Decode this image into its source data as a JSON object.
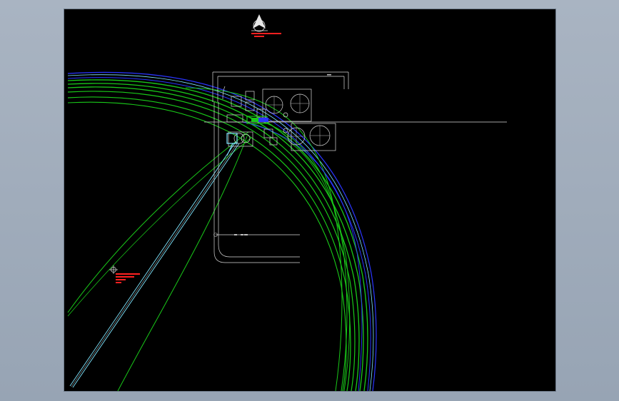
{
  "app": {
    "name": "CAD viewer",
    "viewport_background": "#000000",
    "frame_background": "#9ba8b8"
  },
  "drawing": {
    "layers": [
      {
        "name": "green-arcs",
        "color": "#19c819"
      },
      {
        "name": "blue-arcs",
        "color": "#2a35ff"
      },
      {
        "name": "cyan-lines",
        "color": "#7fe6ff"
      },
      {
        "name": "plan-linework",
        "color": "#d8d8d8"
      },
      {
        "name": "annotation-red",
        "color": "#ff2020"
      }
    ],
    "icons": [
      "north-arrow-icon",
      "crosshair-marker-icon"
    ],
    "annotations": []
  }
}
